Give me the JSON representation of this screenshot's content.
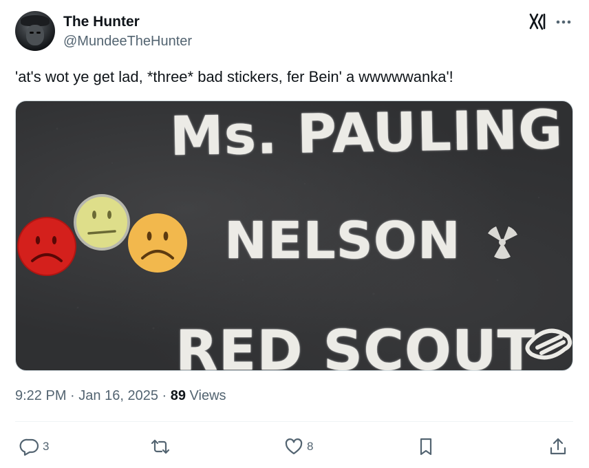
{
  "author": {
    "display_name": "The Hunter",
    "handle": "@MundeeTheHunter",
    "avatar_icon": "avatar"
  },
  "header_actions": {
    "grok_icon": "grok-icon",
    "more_icon": "more-icon"
  },
  "tweet": {
    "text": "'at's wot ye get lad, *three* bad stickers, fer Bein' a wwwwwanka'!"
  },
  "media": {
    "lines": [
      "Ms. PAULING",
      "NELSON",
      "RED SCOUT"
    ],
    "stickers": [
      {
        "mood": "sad",
        "color": "#d4201c"
      },
      {
        "mood": "neutral",
        "color": "#dede8a"
      },
      {
        "mood": "sad",
        "color": "#f2b84d"
      }
    ]
  },
  "meta": {
    "time": "9:22 PM",
    "separator": "·",
    "date": "Jan 16, 2025",
    "views_count": "89",
    "views_label": "Views"
  },
  "actions": {
    "reply_count": "3",
    "retweet_count": "",
    "like_count": "8"
  },
  "colors": {
    "text": "#0f1419",
    "secondary": "#536471",
    "chalkboard": "#2f3032"
  }
}
